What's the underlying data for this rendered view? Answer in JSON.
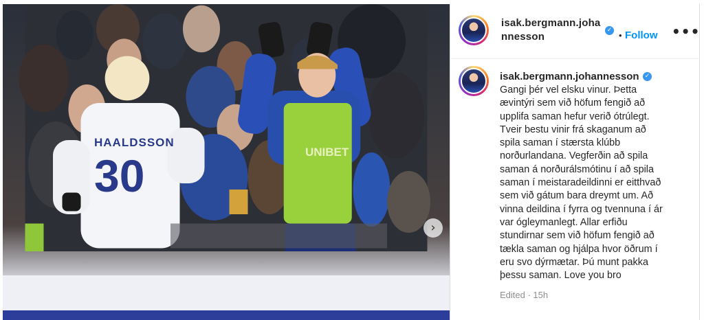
{
  "photo": {
    "jersey_name": "HAALDSSON",
    "jersey_number": "30",
    "vest_sponsor": "UNIBET",
    "carousel_next_icon": "chevron-right-icon"
  },
  "header": {
    "username_line1": "isak.bergmann.joha",
    "username_line2": "nnesson",
    "verified_icon": "verified-badge-icon",
    "separator": "•",
    "follow_label": "Follow",
    "more_label": "•••"
  },
  "post": {
    "username": "isak.bergmann.johannesson",
    "caption_lines": [
      "Gangi þér vel elsku vinur. Þetta",
      "ævintýri sem við höfum fengið að",
      "upplifa saman hefur verið ótrúlegt.",
      "Tveir bestu vinir frá skaganum að",
      "spila saman í stærsta klúbb",
      "norðurlandana. Vegferðin að spila",
      "saman á norðurálsmótinu í að spila",
      "saman í meistaradeildinni er eitthvað",
      "sem við gátum bara dreymt um. Að",
      "vinna deildina í fyrra og tvennuna í ár",
      "var ógleymanlegt. Allar erfiðu",
      "stundirnar sem við höfum fengið að",
      "tækla saman og hjálpa hvor öðrum í",
      "eru svo dýrmætar. Þú munt pakka",
      "þessu saman. Love you bro"
    ],
    "meta": "Edited · 15h"
  },
  "colors": {
    "accent": "#0095f6",
    "verified": "#3897f0",
    "text": "#262626",
    "muted": "#8e8e8e"
  }
}
